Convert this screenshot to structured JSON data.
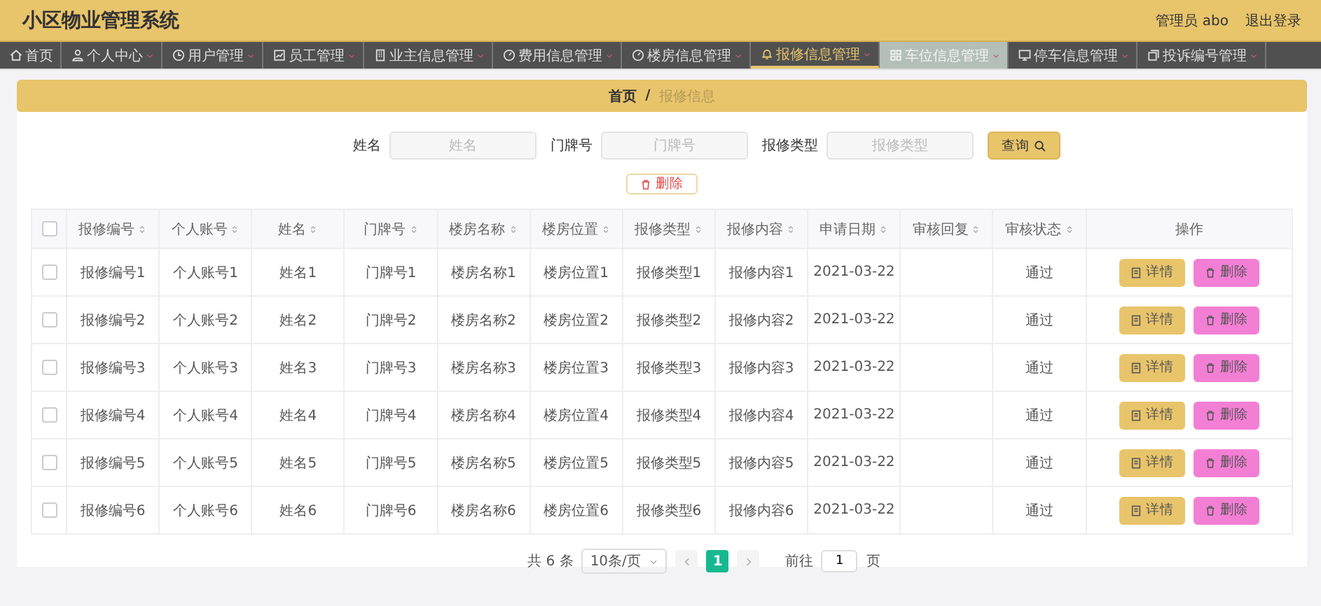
{
  "header": {
    "title": "小区物业管理系统",
    "user": "管理员 abo",
    "logout": "退出登录"
  },
  "nav": [
    {
      "label": "首页",
      "dropdown": false,
      "selected": false,
      "hovered": false
    },
    {
      "label": "个人中心",
      "dropdown": true,
      "selected": false,
      "hovered": false
    },
    {
      "label": "用户管理",
      "dropdown": true,
      "selected": false,
      "hovered": false
    },
    {
      "label": "员工管理",
      "dropdown": true,
      "selected": false,
      "hovered": false
    },
    {
      "label": "业主信息管理",
      "dropdown": true,
      "selected": false,
      "hovered": false
    },
    {
      "label": "费用信息管理",
      "dropdown": true,
      "selected": false,
      "hovered": false
    },
    {
      "label": "楼房信息管理",
      "dropdown": true,
      "selected": false,
      "hovered": false
    },
    {
      "label": "报修信息管理",
      "dropdown": true,
      "selected": true,
      "hovered": false
    },
    {
      "label": "车位信息管理",
      "dropdown": true,
      "selected": false,
      "hovered": true
    },
    {
      "label": "停车信息管理",
      "dropdown": true,
      "selected": false,
      "hovered": false
    },
    {
      "label": "投诉编号管理",
      "dropdown": true,
      "selected": false,
      "hovered": false
    }
  ],
  "breadcrumb": {
    "items": [
      {
        "label": "首页",
        "current": false
      },
      {
        "label": "报修信息",
        "current": true
      }
    ],
    "separator": "/"
  },
  "search": {
    "fields": [
      {
        "label": "姓名",
        "placeholder": "姓名"
      },
      {
        "label": "门牌号",
        "placeholder": "门牌号"
      },
      {
        "label": "报修类型",
        "placeholder": "报修类型"
      }
    ],
    "button": "查询"
  },
  "batch_delete": "删除",
  "table": {
    "select_all": {
      "checked": false
    },
    "columns": [
      {
        "label": "报修编号",
        "sortable": true
      },
      {
        "label": "个人账号",
        "sortable": true
      },
      {
        "label": "姓名",
        "sortable": true
      },
      {
        "label": "门牌号",
        "sortable": true
      },
      {
        "label": "楼房名称",
        "sortable": true
      },
      {
        "label": "楼房位置",
        "sortable": true
      },
      {
        "label": "报修类型",
        "sortable": true
      },
      {
        "label": "报修内容",
        "sortable": true
      },
      {
        "label": "申请日期",
        "sortable": true
      },
      {
        "label": "审核回复",
        "sortable": true
      },
      {
        "label": "审核状态",
        "sortable": true
      },
      {
        "label": "操作",
        "sortable": false
      }
    ],
    "rows": [
      {
        "checked": false,
        "cells": [
          "报修编号1",
          "个人账号1",
          "姓名1",
          "门牌号1",
          "楼房名称1",
          "楼房位置1",
          "报修类型1",
          "报修内容1",
          "2021-03-22",
          null,
          "通过"
        ],
        "actions": [
          {
            "kind": "detail",
            "label": "详情"
          },
          {
            "kind": "delete",
            "label": "删除"
          }
        ]
      },
      {
        "checked": false,
        "cells": [
          "报修编号2",
          "个人账号2",
          "姓名2",
          "门牌号2",
          "楼房名称2",
          "楼房位置2",
          "报修类型2",
          "报修内容2",
          "2021-03-22",
          null,
          "通过"
        ],
        "actions": [
          {
            "kind": "detail",
            "label": "详情"
          },
          {
            "kind": "delete",
            "label": "删除"
          }
        ]
      },
      {
        "checked": false,
        "cells": [
          "报修编号3",
          "个人账号3",
          "姓名3",
          "门牌号3",
          "楼房名称3",
          "楼房位置3",
          "报修类型3",
          "报修内容3",
          "2021-03-22",
          null,
          "通过"
        ],
        "actions": [
          {
            "kind": "detail",
            "label": "详情"
          },
          {
            "kind": "delete",
            "label": "删除"
          }
        ]
      },
      {
        "checked": false,
        "cells": [
          "报修编号4",
          "个人账号4",
          "姓名4",
          "门牌号4",
          "楼房名称4",
          "楼房位置4",
          "报修类型4",
          "报修内容4",
          "2021-03-22",
          null,
          "通过"
        ],
        "actions": [
          {
            "kind": "detail",
            "label": "详情"
          },
          {
            "kind": "delete",
            "label": "删除"
          }
        ]
      },
      {
        "checked": false,
        "cells": [
          "报修编号5",
          "个人账号5",
          "姓名5",
          "门牌号5",
          "楼房名称5",
          "楼房位置5",
          "报修类型5",
          "报修内容5",
          "2021-03-22",
          null,
          "通过"
        ],
        "actions": [
          {
            "kind": "detail",
            "label": "详情"
          },
          {
            "kind": "delete",
            "label": "删除"
          }
        ]
      },
      {
        "checked": false,
        "cells": [
          "报修编号6",
          "个人账号6",
          "姓名6",
          "门牌号6",
          "楼房名称6",
          "楼房位置6",
          "报修类型6",
          "报修内容6",
          "2021-03-22",
          null,
          "通过"
        ],
        "actions": [
          {
            "kind": "detail",
            "label": "详情"
          },
          {
            "kind": "delete",
            "label": "删除"
          }
        ]
      }
    ]
  },
  "pagination": {
    "total": "共 6 条",
    "page_size": "10条/页",
    "pages": [
      {
        "label": "1",
        "selected": true
      }
    ],
    "goto_label": "前往",
    "goto_value": "1",
    "goto_suffix": "页"
  }
}
